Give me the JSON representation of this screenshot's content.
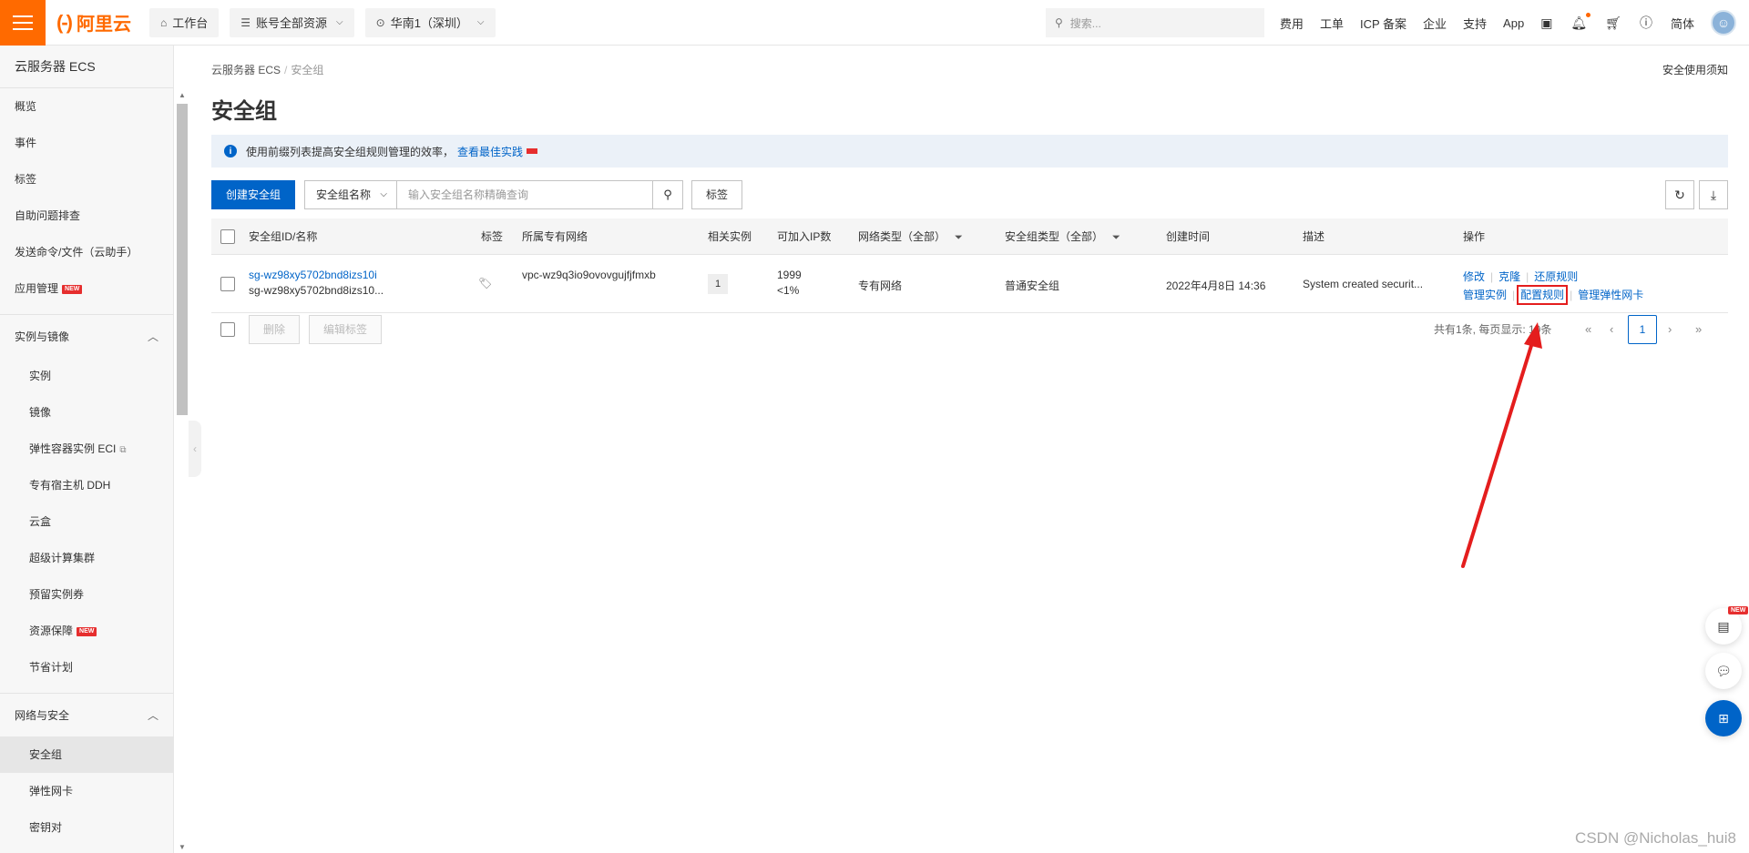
{
  "header": {
    "logo_text": "阿里云",
    "logo_mark": "(-)",
    "workbench": "工作台",
    "account_resources": "账号全部资源",
    "region": "华南1（深圳）",
    "search_placeholder": "搜索...",
    "links": [
      "费用",
      "工单",
      "ICP 备案",
      "企业",
      "支持",
      "App"
    ],
    "language": "简体"
  },
  "sidebar": {
    "title": "云服务器 ECS",
    "top_items": [
      "概览",
      "事件",
      "标签",
      "自助问题排查",
      "发送命令/文件（云助手）"
    ],
    "app_mgmt": "应用管理",
    "new_badge": "NEW",
    "group1": {
      "label": "实例与镜像",
      "items": [
        "实例",
        "镜像",
        "弹性容器实例 ECI",
        "专有宿主机 DDH",
        "云盒",
        "超级计算集群",
        "预留实例券",
        "资源保障",
        "节省计划"
      ]
    },
    "group2": {
      "label": "网络与安全",
      "items": [
        "安全组",
        "弹性网卡",
        "密钥对"
      ]
    }
  },
  "main": {
    "breadcrumb": [
      "云服务器 ECS",
      "安全组"
    ],
    "breadcrumb_sep": "/",
    "notice_link": "安全使用须知",
    "title": "安全组",
    "alert_text": "使用前缀列表提高安全组规则管理的效率，",
    "alert_link": "查看最佳实践",
    "toolbar": {
      "create": "创建安全组",
      "filter_select": "安全组名称",
      "search_placeholder": "输入安全组名称精确查询",
      "tag": "标签"
    },
    "table": {
      "headers": [
        "安全组ID/名称",
        "标签",
        "所属专有网络",
        "相关实例",
        "可加入IP数",
        "网络类型（全部）",
        "安全组类型（全部）",
        "创建时间",
        "描述",
        "操作"
      ],
      "rows": [
        {
          "id": "sg-wz98xy5702bnd8izs10i",
          "name": "sg-wz98xy5702bnd8izs10...",
          "vpc": "vpc-wz9q3io9ovovgujfjfmxb",
          "instances": "1",
          "ip_count": "1999",
          "ip_percent": "<1%",
          "network_type": "专有网络",
          "sg_type": "普通安全组",
          "created": "2022年4月8日 14:36",
          "description": "System created securit...",
          "ops_row1": [
            "修改",
            "克隆",
            "还原规则"
          ],
          "ops_row2": [
            "管理实例",
            "配置规则",
            "管理弹性网卡"
          ]
        }
      ]
    },
    "footer": {
      "delete": "删除",
      "edit_tag": "编辑标签",
      "summary": "共有1条, 每页显示: 10条",
      "first": "«",
      "prev": "‹",
      "page": "1",
      "next": "›",
      "last": "»"
    }
  },
  "watermark": "CSDN @Nicholas_hui8",
  "float_new": "NEW",
  "colors": {
    "brand": "#ff6a00",
    "primary": "#0064c8",
    "annotation": "#e41d1d"
  }
}
